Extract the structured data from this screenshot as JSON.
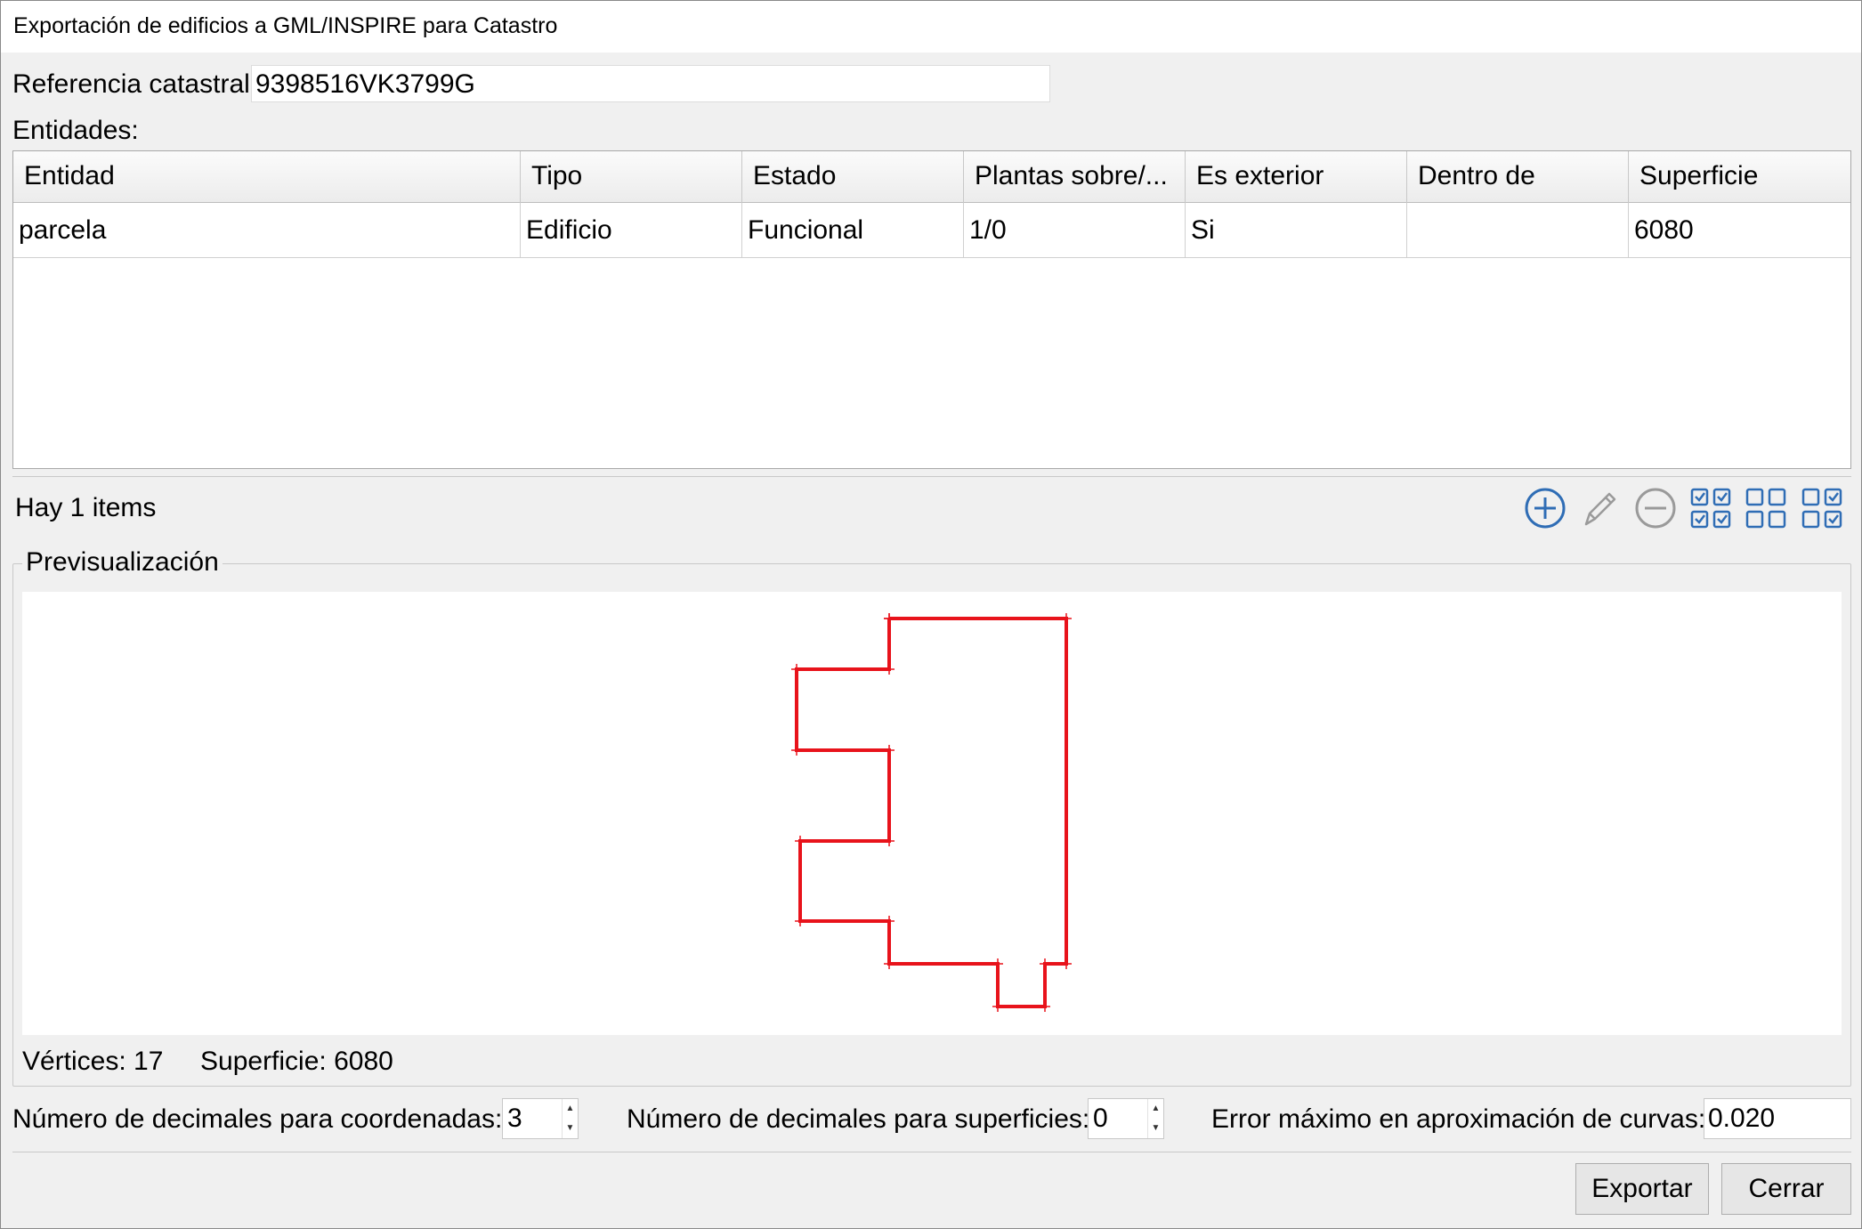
{
  "window": {
    "title": "Exportación de edificios a GML/INSPIRE para Catastro"
  },
  "ref": {
    "label": "Referencia catastral:",
    "value": "9398516VK3799G"
  },
  "entities": {
    "label": "Entidades:",
    "columns": [
      "Entidad",
      "Tipo",
      "Estado",
      "Plantas sobre/...",
      "Es exterior",
      "Dentro de",
      "Superficie"
    ],
    "rows": [
      [
        "parcela",
        "Edificio",
        "Funcional",
        "1/0",
        "Si",
        "",
        "6080"
      ]
    ]
  },
  "status": {
    "count_text": "Hay 1 items"
  },
  "toolbar": {
    "icons": [
      "add-icon",
      "edit-icon",
      "remove-icon",
      "check-all-icon",
      "uncheck-all-icon",
      "invert-check-icon"
    ]
  },
  "preview": {
    "title": "Previsualización",
    "vertices_label": "Vértices: 17",
    "area_label": "Superficie: 6080",
    "stroke_color": "#e8131b"
  },
  "options": {
    "coord_label": "Número de decimales para coordenadas:",
    "coord_value": "3",
    "area_label": "Número de decimales para superficies:",
    "area_value": "0",
    "curve_label": "Error máximo en aproximación de curvas:",
    "curve_value": "0.020"
  },
  "buttons": {
    "export": "Exportar",
    "close": "Cerrar"
  }
}
